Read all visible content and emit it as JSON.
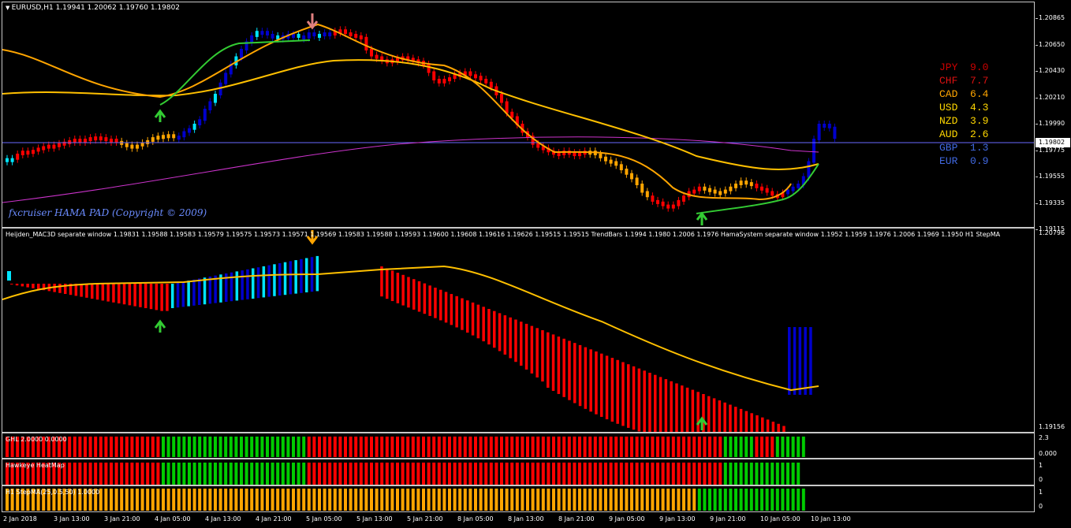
{
  "main_chart": {
    "title": "EURUSD,H1  1.19941 1.20062 1.19760 1.19802",
    "price_axis": [
      "1.20865",
      "1.20650",
      "1.20430",
      "1.20210",
      "1.19990",
      "1.19775",
      "1.19555",
      "1.19335",
      "1.19115"
    ],
    "current_price": "1.19802",
    "copyright": "fxcruiser HAMA PAD (Copyright © 2009)",
    "currency_strength": [
      {
        "code": "JPY",
        "value": "9.0",
        "color": "#cc0000"
      },
      {
        "code": "CHF",
        "value": "7.7",
        "color": "#dd1111"
      },
      {
        "code": "CAD",
        "value": "6.4",
        "color": "#ffa500"
      },
      {
        "code": "USD",
        "value": "4.3",
        "color": "#ffd700"
      },
      {
        "code": "NZD",
        "value": "3.9",
        "color": "#ffd700"
      },
      {
        "code": "AUD",
        "value": "2.6",
        "color": "#ffd700"
      },
      {
        "code": "GBP",
        "value": "1.3",
        "color": "#4169e1"
      },
      {
        "code": "EUR",
        "value": "0.9",
        "color": "#4169e1"
      }
    ]
  },
  "mac_window": {
    "title": "Heijden_MAC3D separate window 1.19831 1.19588 1.19583 1.19579 1.19575 1.19573 1.19571 1.19569 1.19583 1.19588 1.19593 1.19600 1.19608 1.19616 1.19626 1.19515 1.19515  TrendBars 1.1994 1.1980 1.2006 1.1976  HamaSystem separate window 1.1952 1.1959 1.1976 1.2006 1.1969 1.1950  H1 StepMA",
    "axis_top": "1.20796",
    "axis_bottom": "1.19156"
  },
  "ghl": {
    "title": "GHL 2.0000 0.0000",
    "axis_top": "2.3",
    "axis_bottom": "0.000"
  },
  "hawkeye": {
    "title": "Hawkeye HeatMap",
    "axis_top": "1",
    "axis_bottom": "0"
  },
  "stepma": {
    "title": "H1 StepMA(25,0.5,50) 1.0000",
    "axis_top": "1",
    "axis_bottom": "0"
  },
  "time_axis": [
    "2 Jan 2018",
    "3 Jan 13:00",
    "3 Jan 21:00",
    "4 Jan 05:00",
    "4 Jan 13:00",
    "4 Jan 21:00",
    "5 Jan 05:00",
    "5 Jan 13:00",
    "5 Jan 21:00",
    "8 Jan 05:00",
    "8 Jan 13:00",
    "8 Jan 21:00",
    "9 Jan 05:00",
    "9 Jan 13:00",
    "9 Jan 21:00",
    "10 Jan 05:00",
    "10 Jan 13:00"
  ],
  "colors": {
    "bull": "#ff0000",
    "bear_up": "#0000cc",
    "cyan": "#00e5ff",
    "orange": "#ffa500",
    "gold": "#ffc000",
    "green": "#00cc00",
    "magenta": "#cc33cc",
    "priceline": "#6a6aff"
  }
}
